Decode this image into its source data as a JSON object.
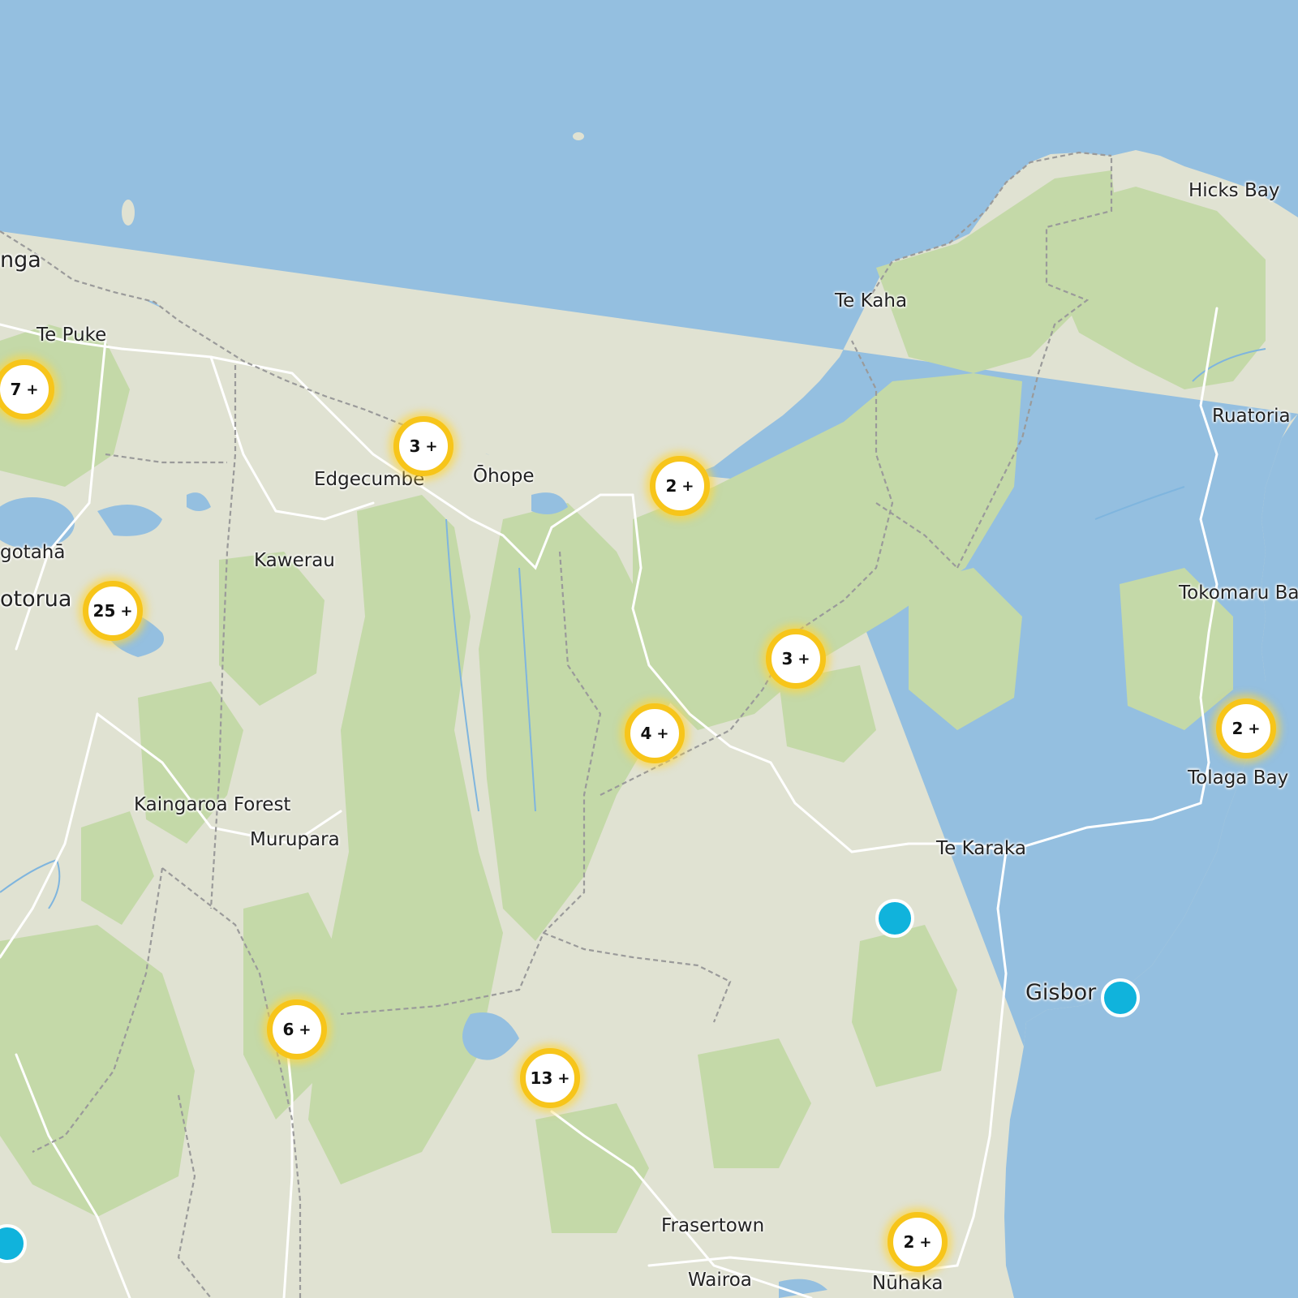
{
  "map": {
    "colors": {
      "water": "#94bfe0",
      "land": "#e0e2d2",
      "forest": "#c4d9a8",
      "forest_dark": "#b3d196",
      "road": "#ffffff",
      "boundary": "#9a9a9a",
      "cluster_ring": "#f7c51a",
      "marker": "#10b3dc"
    },
    "labels": [
      {
        "text": "nga",
        "size": "big"
      },
      {
        "text": "Te Puke"
      },
      {
        "text": "Edgecumbe"
      },
      {
        "text": "Ōhope"
      },
      {
        "text": "Te Kaha"
      },
      {
        "text": "Hicks Bay"
      },
      {
        "text": "Ruatoria"
      },
      {
        "text": "gotahā"
      },
      {
        "text": "Kawerau"
      },
      {
        "text": "otorua",
        "size": "big"
      },
      {
        "text": "Tokomaru Ba"
      },
      {
        "text": "Tolaga Bay"
      },
      {
        "text": "Kaingaroa Forest"
      },
      {
        "text": "Murupara"
      },
      {
        "text": "Te Karaka"
      },
      {
        "text": "Gisbor",
        "size": "big"
      },
      {
        "text": "Frasertown"
      },
      {
        "text": "Wairoa"
      },
      {
        "text": "Nūhaka"
      }
    ],
    "clusters": [
      {
        "count": "7",
        "plus": "+"
      },
      {
        "count": "3",
        "plus": "+"
      },
      {
        "count": "2",
        "plus": "+"
      },
      {
        "count": "25",
        "plus": "+"
      },
      {
        "count": "3",
        "plus": "+"
      },
      {
        "count": "4",
        "plus": "+"
      },
      {
        "count": "2",
        "plus": "+"
      },
      {
        "count": "6",
        "plus": "+"
      },
      {
        "count": "13",
        "plus": "+"
      },
      {
        "count": "2",
        "plus": "+"
      }
    ],
    "markers": [
      {
        "icon": "location-dot-icon"
      },
      {
        "icon": "location-dot-icon"
      },
      {
        "icon": "location-dot-icon"
      }
    ]
  }
}
